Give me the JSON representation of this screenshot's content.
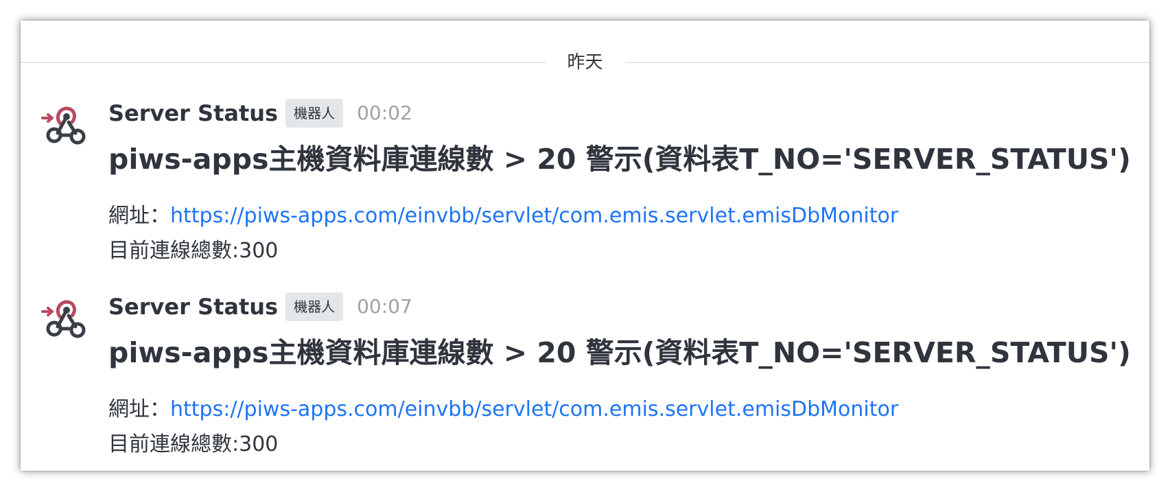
{
  "day_divider": {
    "label": "昨天"
  },
  "messages": [
    {
      "avatar_icon": "webhook-icon",
      "sender": "Server Status",
      "badge": "機器人",
      "time": "00:02",
      "title": "piws-apps主機資料庫連線數 > 20 警示(資料表T_NO='SERVER_STATUS')",
      "url_label": "網址：",
      "url": "https://piws-apps.com/einvbb/servlet/com.emis.servlet.emisDbMonitor",
      "count_text": "目前連線總數:300"
    },
    {
      "avatar_icon": "webhook-icon",
      "sender": "Server Status",
      "badge": "機器人",
      "time": "00:07",
      "title": "piws-apps主機資料庫連線數 > 20 警示(資料表T_NO='SERVER_STATUS')",
      "url_label": "網址：",
      "url": "https://piws-apps.com/einvbb/servlet/com.emis.servlet.emisDbMonitor",
      "count_text": "目前連線總數:300"
    }
  ],
  "colors": {
    "text": "#2f343d",
    "link": "#1d74f5",
    "muted": "#9ea2a8",
    "badge_bg": "#e4e7ea",
    "webhook_accent": "#b8495e",
    "webhook_dark": "#3a3f47"
  }
}
